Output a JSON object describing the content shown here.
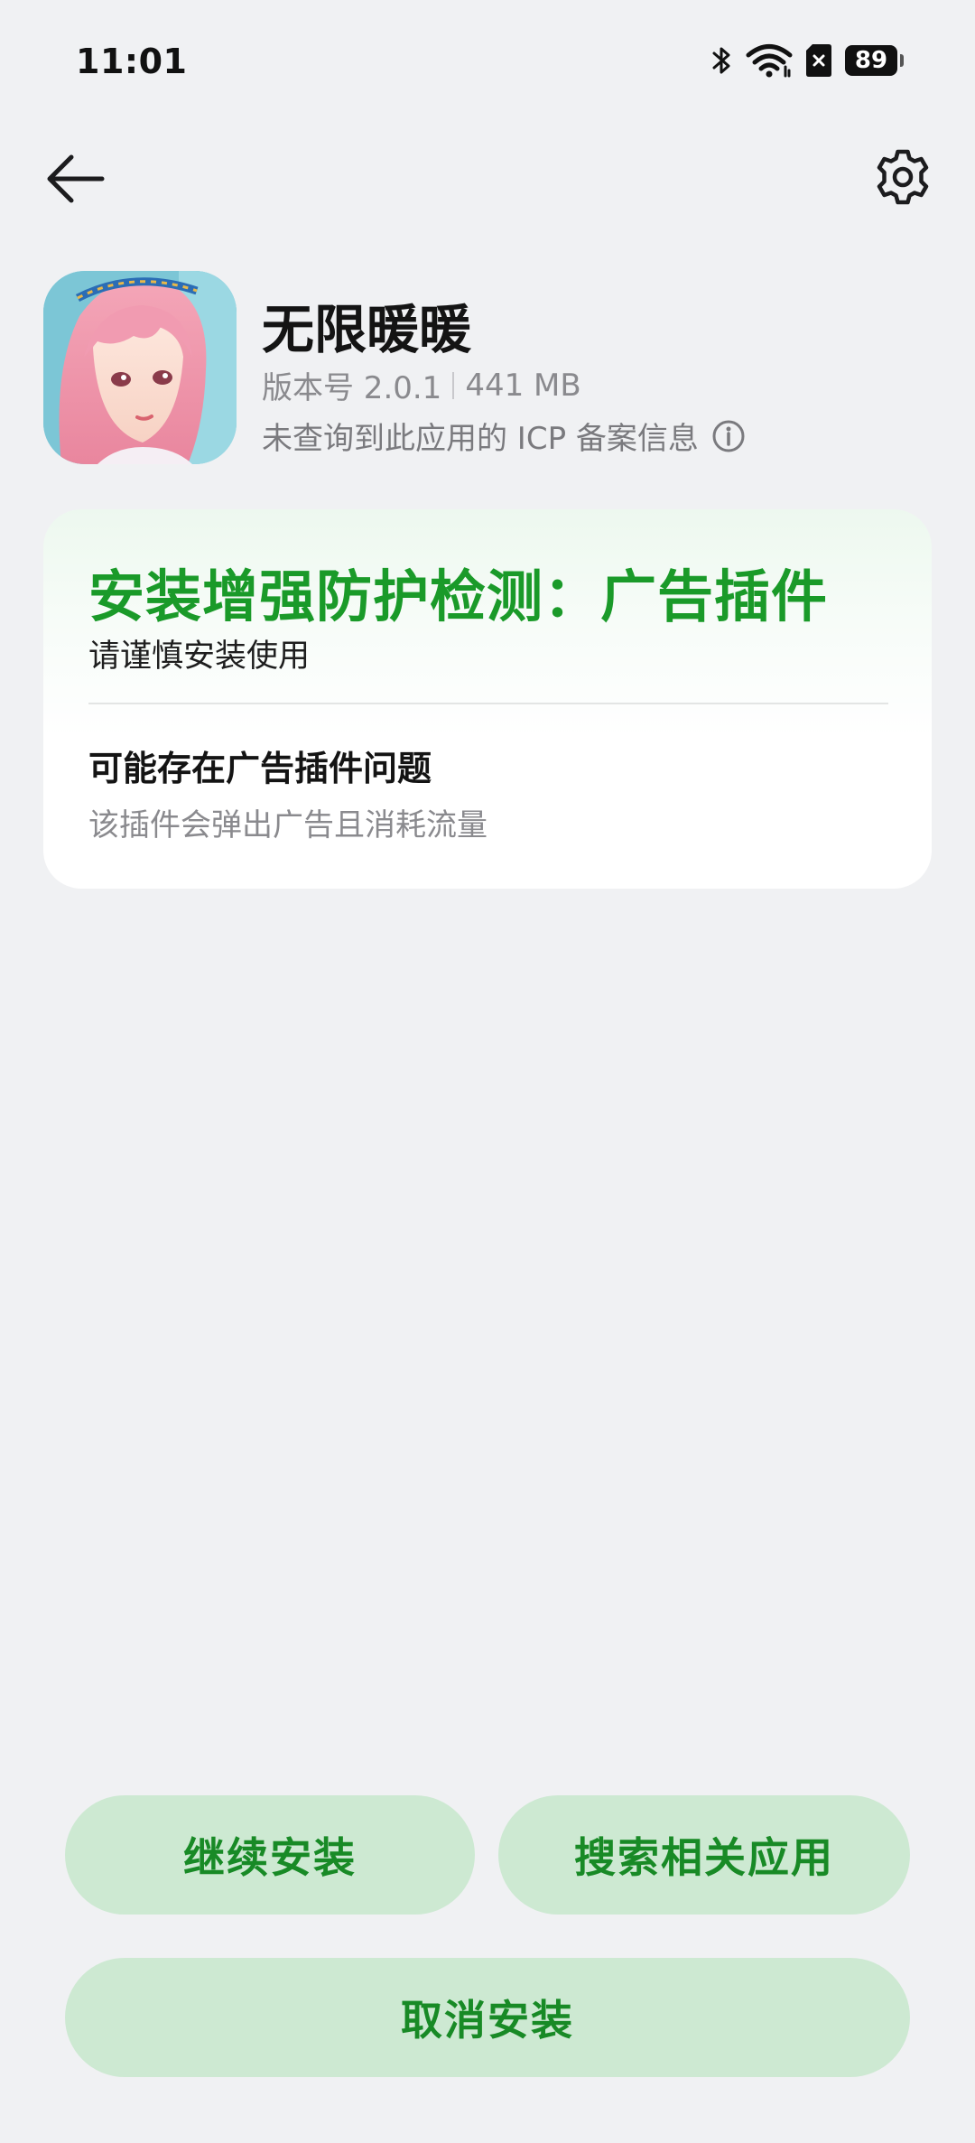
{
  "status_bar": {
    "time": "11:01",
    "battery_level": "89",
    "icons": [
      "bluetooth-icon",
      "wifi-icon",
      "no-sim-icon",
      "battery-icon"
    ]
  },
  "nav": {
    "back_icon": "back-arrow-icon",
    "settings_icon": "gear-icon"
  },
  "app": {
    "name": "无限暖暖",
    "version": "版本号 2.0.1",
    "size": "441 MB",
    "icp_notice": "未查询到此应用的 ICP 备案信息",
    "icp_info_icon": "info-icon"
  },
  "warning": {
    "title": "安装增强防护检测：广告插件",
    "subtitle": "请谨慎安装使用",
    "issue_title": "可能存在广告插件问题",
    "issue_desc": "该插件会弹出广告且消耗流量"
  },
  "actions": {
    "continue_label": "继续安装",
    "search_label": "搜索相关应用",
    "cancel_label": "取消安装"
  },
  "colors": {
    "background": "#f0f1f3",
    "accent_green": "#1a9a29",
    "button_bg": "#cde9d2",
    "button_text": "#188a26"
  }
}
